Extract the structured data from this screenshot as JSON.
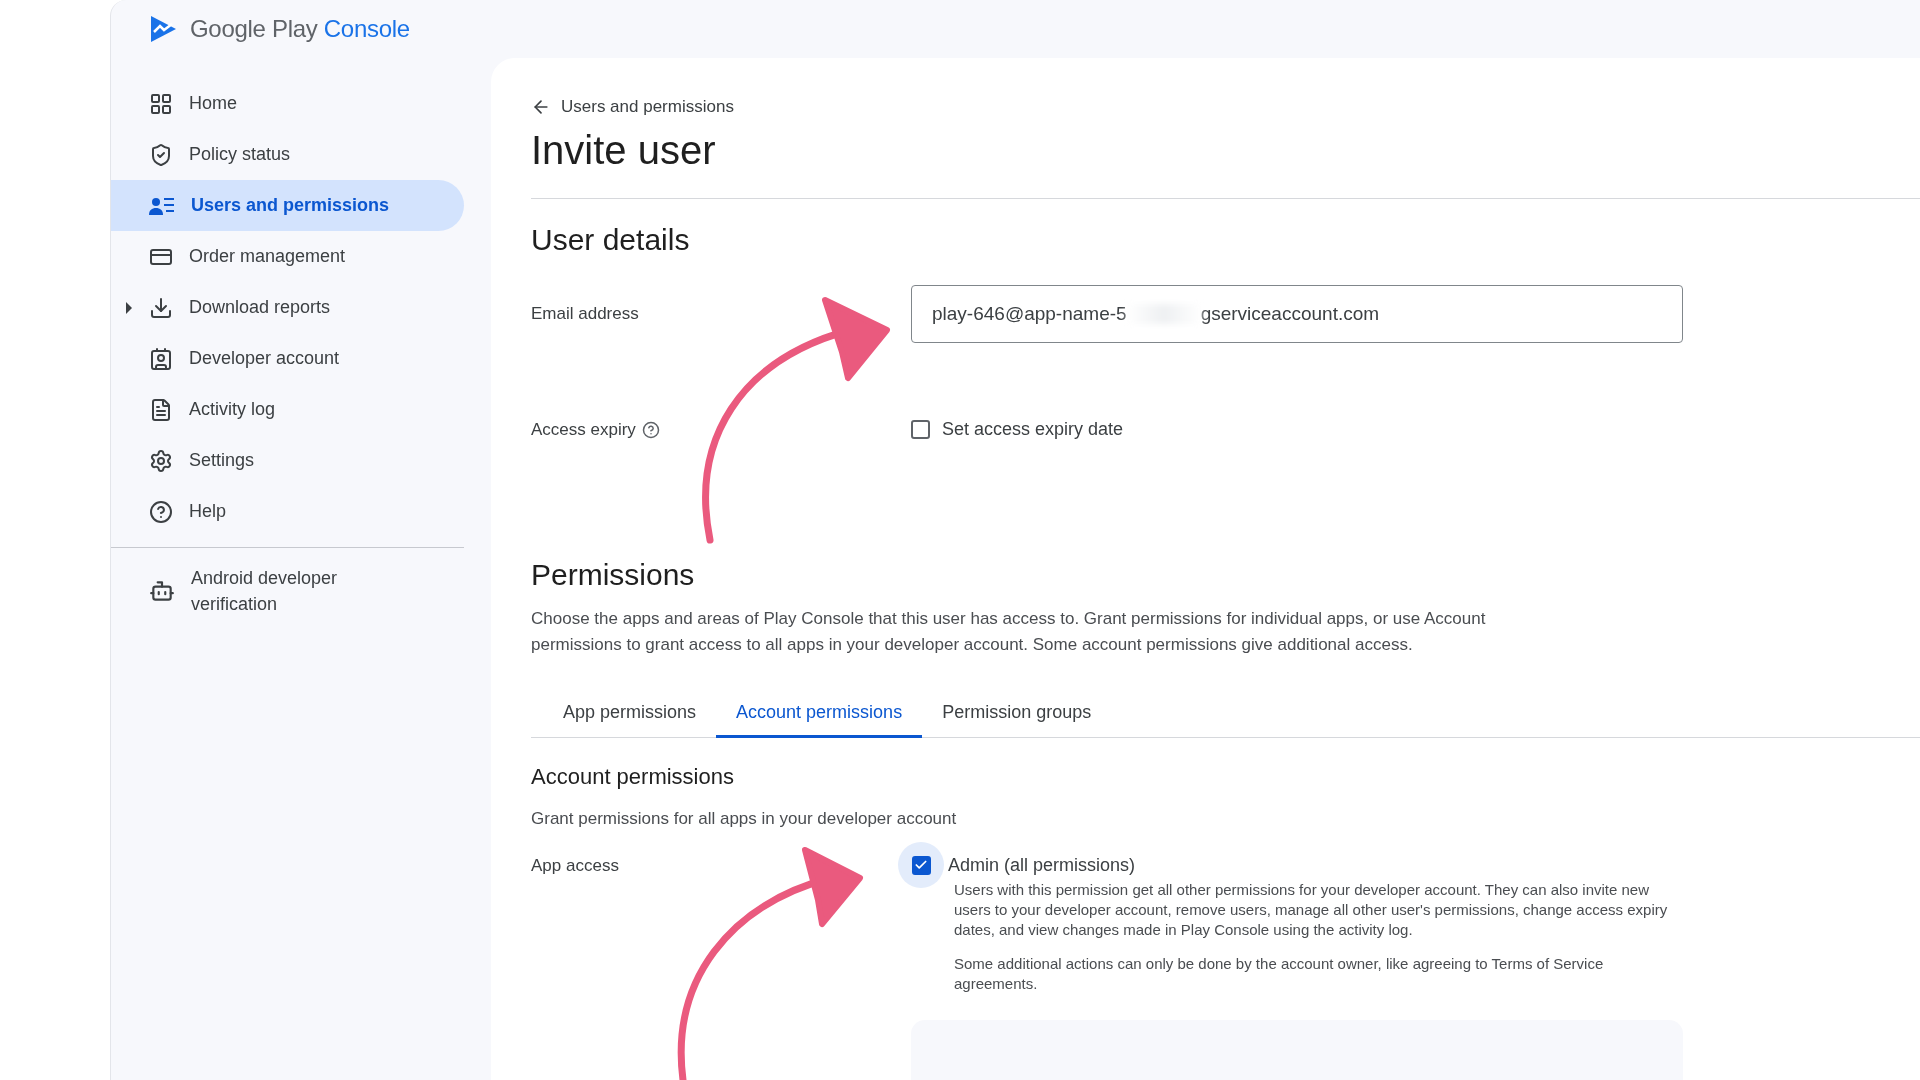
{
  "brand": {
    "name": "Google Play",
    "product": "Console"
  },
  "sidebar": {
    "items": [
      {
        "label": "Home",
        "kind": "link",
        "selected": false
      },
      {
        "label": "Policy status",
        "kind": "link",
        "selected": false
      },
      {
        "label": "Users and permissions",
        "kind": "link",
        "selected": true
      },
      {
        "label": "Order management",
        "kind": "link",
        "selected": false
      },
      {
        "label": "Download reports",
        "kind": "group",
        "selected": false,
        "expanded": false
      },
      {
        "label": "Developer account",
        "kind": "link",
        "selected": false
      },
      {
        "label": "Activity log",
        "kind": "link",
        "selected": false
      },
      {
        "label": "Settings",
        "kind": "link",
        "selected": false
      },
      {
        "label": "Help",
        "kind": "link",
        "selected": false
      }
    ],
    "footer_items": [
      {
        "label": "Android developer verification"
      }
    ]
  },
  "breadcrumb": "Users and permissions",
  "title": "Invite user",
  "user_details": {
    "heading": "User details",
    "email": {
      "label": "Email address",
      "value_start": "play-646@app-name-5",
      "value_end": "gserviceaccount.com"
    },
    "access_expiry": {
      "label": "Access expiry",
      "checkbox_label": "Set access expiry date",
      "checked": false
    }
  },
  "permissions": {
    "heading": "Permissions",
    "description": "Choose the apps and areas of Play Console that this user has access to. Grant permissions for individual apps, or use Account permissions to grant access to all apps in your developer account. Some account permissions give additional access.",
    "tabs": [
      {
        "label": "App permissions",
        "selected": false
      },
      {
        "label": "Account permissions",
        "selected": true
      },
      {
        "label": "Permission groups",
        "selected": false
      }
    ],
    "account": {
      "heading": "Account permissions",
      "subtitle": "Grant permissions for all apps in your developer account",
      "app_access": {
        "label": "App access",
        "option": "Admin (all permissions)",
        "checked": true,
        "details": [
          "Users with this permission get all other permissions for your developer account. They can also invite new users to your developer account, remove users, manage all other user's permissions, change access expiry dates, and view changes made in Play Console using the activity log.",
          "Some additional actions can only be done by the account owner, like agreeing to Terms of Service agreements."
        ]
      }
    }
  }
}
